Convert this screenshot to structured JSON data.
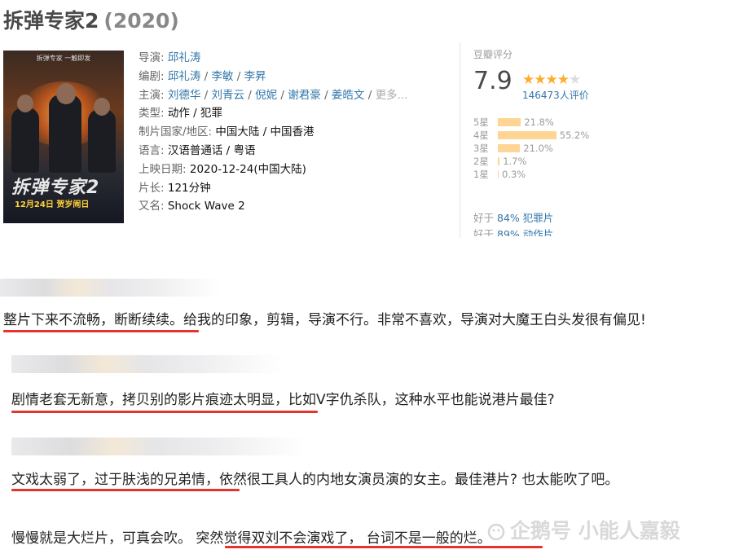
{
  "movie": {
    "title": "拆弹专家2",
    "year": "(2020)"
  },
  "poster": {
    "tagline": "拆弹专家   一触即发",
    "title_text": "拆弹专家2",
    "release_text": "12月24日  贺岁闹日"
  },
  "info": {
    "director": {
      "label": "导演:",
      "names": [
        "邱礼涛"
      ]
    },
    "writer": {
      "label": "编剧:",
      "names": [
        "邱礼涛",
        "李敏",
        "李昇"
      ]
    },
    "cast": {
      "label": "主演:",
      "names": [
        "刘德华",
        "刘青云",
        "倪妮",
        "谢君豪",
        "姜皓文"
      ],
      "more": "更多..."
    },
    "genre": {
      "label": "类型:",
      "values": [
        "动作",
        "犯罪"
      ]
    },
    "country": {
      "label": "制片国家/地区:",
      "value": "中国大陆 / 中国香港"
    },
    "language": {
      "label": "语言:",
      "value": "汉语普通话 / 粤语"
    },
    "release": {
      "label": "上映日期:",
      "value": "2020-12-24(中国大陆)"
    },
    "runtime": {
      "label": "片长:",
      "value": "121分钟"
    },
    "aka": {
      "label": "又名:",
      "value": "Shock Wave 2"
    }
  },
  "rating": {
    "label": "豆瓣评分",
    "score": "7.9",
    "stars_filled": 4,
    "stars_total": 5,
    "count_text": "146473人评价",
    "bars": [
      {
        "label": "5星",
        "percent_text": "21.8%",
        "percent": 21.8
      },
      {
        "label": "4星",
        "percent_text": "55.2%",
        "percent": 55.2
      },
      {
        "label": "3星",
        "percent_text": "21.0%",
        "percent": 21.0
      },
      {
        "label": "2星",
        "percent_text": "1.7%",
        "percent": 1.7
      },
      {
        "label": "1星",
        "percent_text": "0.3%",
        "percent": 0.3
      }
    ],
    "better_than": [
      {
        "prefix": "好于",
        "link": "84% 犯罪片"
      },
      {
        "prefix": "好于",
        "link": "89% 动作片"
      }
    ]
  },
  "comments": [
    {
      "text": "整片下来不流畅，断断续续。给我的印象，剪辑，导演不行。非常不喜欢，导演对大魔王白头发很有偏见!"
    },
    {
      "text": "剧情老套无新意，拷贝别的影片痕迹太明显，比如V字仇杀队，这种水平也能说港片最佳?"
    },
    {
      "text": "文戏太弱了，过于肤浅的兄弟情，依然很工具人的内地女演员演的女主。最佳港片? 也太能吹了吧。"
    },
    {
      "text": "慢慢就是大烂片，可真会吹。 突然觉得双刘不会演戏了， 台词不是一般的烂。"
    }
  ],
  "watermark": {
    "text": "企鹅号 小能人嘉毅"
  },
  "colors": {
    "link": "#3377aa",
    "star": "#ffac2d",
    "bar": "#ffd596",
    "underline": "#e3342f"
  }
}
